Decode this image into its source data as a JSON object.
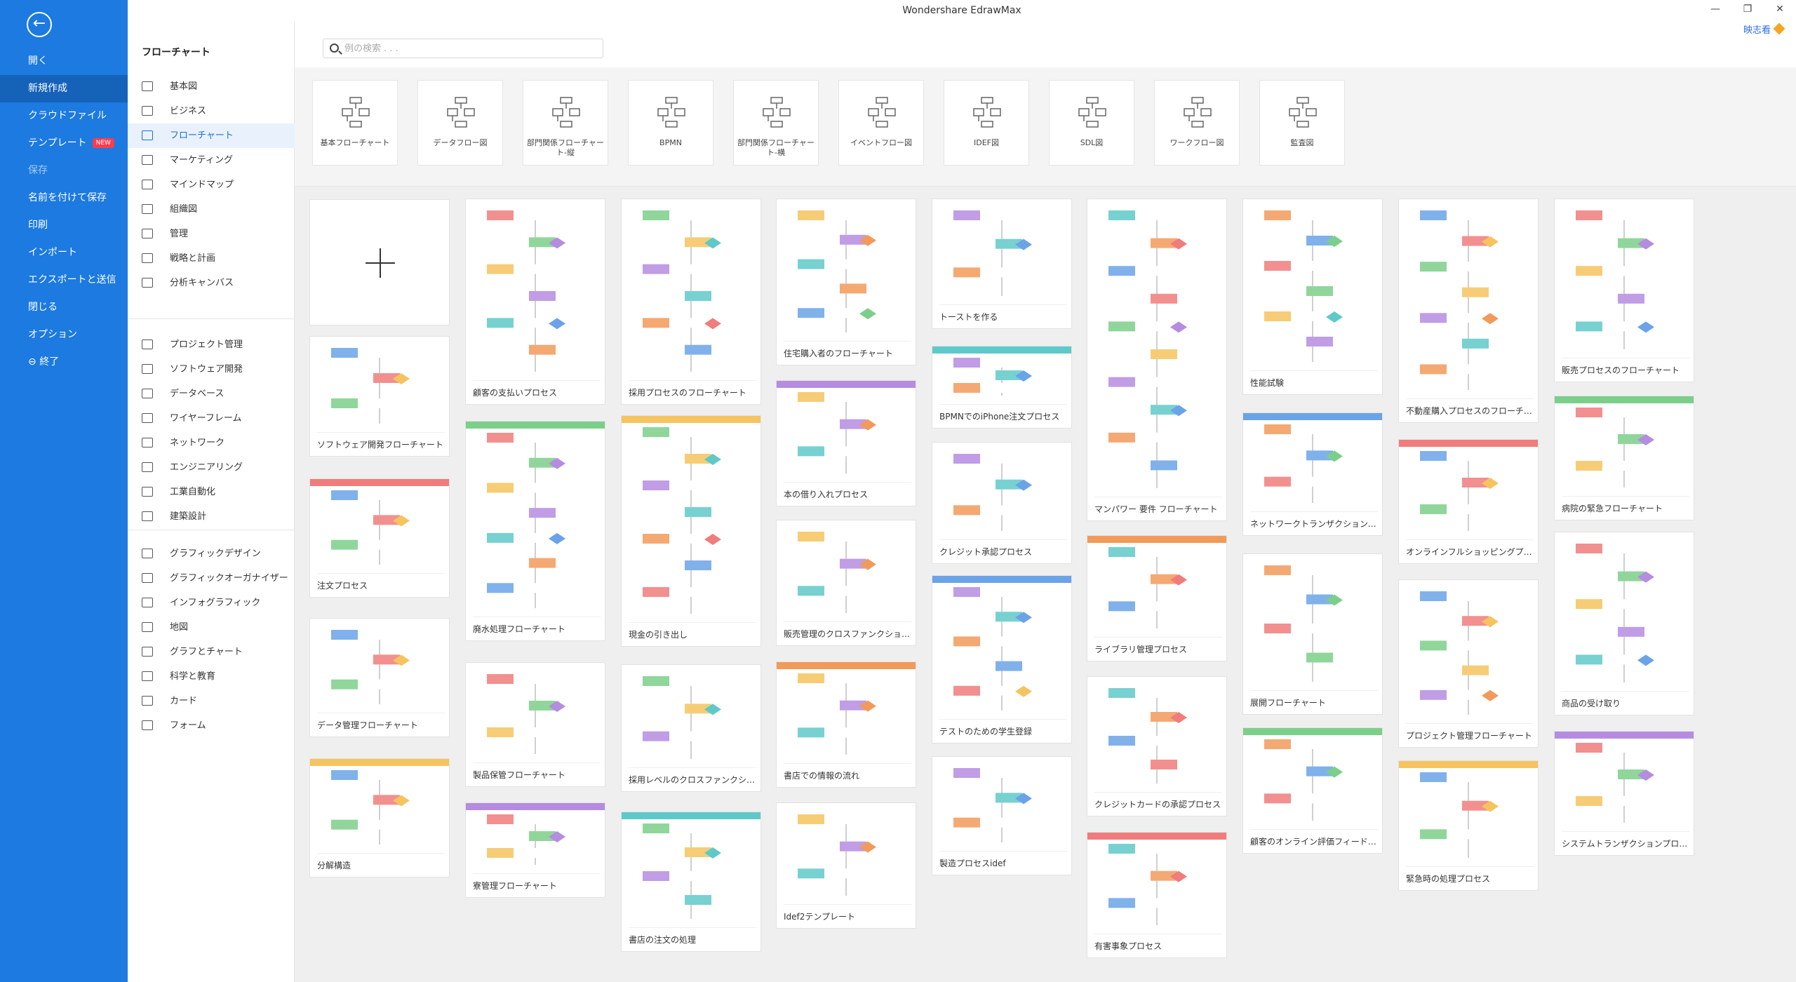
{
  "app": {
    "title": "Wondershare EdrawMax",
    "user": "映志看"
  },
  "window_controls": [
    "—",
    "❐",
    "✕"
  ],
  "left_menu": [
    {
      "label": "開く",
      "state": "normal"
    },
    {
      "label": "新規作成",
      "state": "active"
    },
    {
      "label": "クラウドファイル",
      "state": "normal"
    },
    {
      "label": "テンプレート",
      "state": "normal",
      "badge": "NEW"
    },
    {
      "label": "保存",
      "state": "dim"
    },
    {
      "label": "名前を付けて保存",
      "state": "normal"
    },
    {
      "label": "印刷",
      "state": "normal"
    },
    {
      "label": "インポート",
      "state": "normal"
    },
    {
      "label": "エクスポートと送信",
      "state": "normal"
    },
    {
      "label": "閉じる",
      "state": "normal"
    },
    {
      "label": "オプション",
      "state": "normal"
    },
    {
      "label": "終了",
      "state": "normal"
    }
  ],
  "category_panel": {
    "title": "フローチャート",
    "group1": [
      "基本図",
      "ビジネス",
      "フローチャート",
      "マーケティング",
      "マインドマップ",
      "組織図",
      "管理",
      "戦略と計画",
      "分析キャンバス"
    ],
    "group2": [
      "プロジェクト管理",
      "ソフトウェア開発",
      "データベース",
      "ワイヤーフレーム",
      "ネットワーク",
      "エンジニアリング",
      "工業自動化",
      "建築設計"
    ],
    "group3": [
      "グラフィックデザイン",
      "グラフィックオーガナイザー",
      "インフォグラフィック",
      "地図",
      "グラフとチャート",
      "科学と教育",
      "カード",
      "フォーム"
    ],
    "active": "フローチャート"
  },
  "search": {
    "placeholder": "例の検索 . . ."
  },
  "types": [
    {
      "label": "基本フローチャート"
    },
    {
      "label": "データフロー図"
    },
    {
      "label": "部門関係フローチャート-縦"
    },
    {
      "label": "BPMN"
    },
    {
      "label": "部門関係フローチャート-横"
    },
    {
      "label": "イベントフロー図"
    },
    {
      "label": "IDEF図"
    },
    {
      "label": "SDL図"
    },
    {
      "label": "ワークフロー図"
    },
    {
      "label": "監査図"
    }
  ],
  "templates": {
    "col1": [
      "ソフトウェア開発フローチャート",
      "注文プロセス",
      "データ管理フローチャート",
      "分解構造"
    ],
    "col2": [
      "顧客の支払いプロセス",
      "廃水処理フローチャート",
      "製品保管フローチャート",
      "寮管理フローチャート"
    ],
    "col3": [
      "採用プロセスのフローチャート",
      "現金の引き出し",
      "採用レベルのクロスファンクショナ...",
      "書店の注文の処理"
    ],
    "col4": [
      "住宅購入者のフローチャート",
      "本の借り入れプロセス",
      "販売管理のクロスファンクショナル...",
      "書店での情報の流れ",
      "Idef2テンプレート"
    ],
    "col5": [
      "トーストを作る",
      "BPMNでのiPhone注文プロセス",
      "クレジット承認プロセス",
      "テストのための学生登録",
      "製造プロセスidef"
    ],
    "col6": [
      "マンパワー 要件 フローチャート",
      "ライブラリ管理プロセス",
      "クレジットカードの承認プロセス",
      "有害事象プロセス"
    ],
    "col7": [
      "性能試験",
      "ネットワークトランザクションプロセス",
      "展開フローチャート",
      "顧客のオンライン評価フィードバッ..."
    ],
    "col8": [
      "不動産購入プロセスのフローチャート",
      "オンラインフルショッピングプロセス",
      "プロジェクト管理フローチャート",
      "緊急時の処理プロセス"
    ],
    "col9": [
      "販売プロセスのフローチャート",
      "病院の緊急フローチャート",
      "商品の受け取り",
      "システムトランザクションプロセス"
    ]
  }
}
